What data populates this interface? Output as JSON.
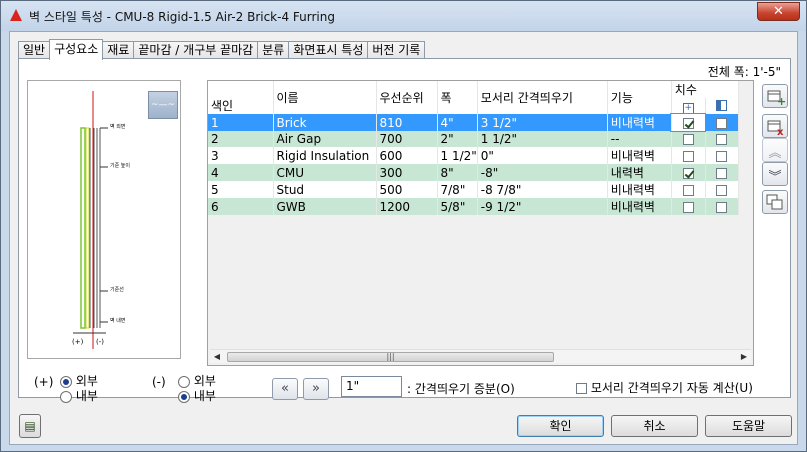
{
  "window": {
    "title": "벽 스타일 특성 - CMU-8 Rigid-1.5 Air-2 Brick-4 Furring",
    "close_glyph": "✕"
  },
  "tabs": [
    {
      "label": "일반"
    },
    {
      "label": "구성요소"
    },
    {
      "label": "재료"
    },
    {
      "label": "끝마감 / 개구부 끝마감"
    },
    {
      "label": "분류"
    },
    {
      "label": "화면표시 특성"
    },
    {
      "label": "버전 기록"
    }
  ],
  "total_width": "전체 폭: 1'-5\"",
  "preview": {
    "thumb_text": "~—~",
    "annotations": [
      "벽 외면",
      "기준 높이",
      "기준선",
      "벽 내면"
    ],
    "bottom_labels": [
      "(+)",
      "(-)"
    ]
  },
  "grid": {
    "headers": {
      "index": "색인",
      "name": "이름",
      "priority": "우선순위",
      "width": "폭",
      "edge_offset": "모서리 간격띄우기",
      "function": "기능",
      "dimension": "치수"
    },
    "rows": [
      {
        "index": "1",
        "name": "Brick",
        "priority": "810",
        "width": "4\"",
        "edge_offset": "3 1/2\"",
        "function": "비내력벽",
        "dim1": true,
        "dim2": false
      },
      {
        "index": "2",
        "name": "Air Gap",
        "priority": "700",
        "width": "2\"",
        "edge_offset": "1 1/2\"",
        "function": "--",
        "dim1": false,
        "dim2": false
      },
      {
        "index": "3",
        "name": "Rigid Insulation",
        "priority": "600",
        "width": "1 1/2\"",
        "edge_offset": "0\"",
        "function": "비내력벽",
        "dim1": false,
        "dim2": false
      },
      {
        "index": "4",
        "name": "CMU",
        "priority": "300",
        "width": "8\"",
        "edge_offset": "-8\"",
        "function": "내력벽",
        "dim1": true,
        "dim2": false
      },
      {
        "index": "5",
        "name": "Stud",
        "priority": "500",
        "width": "7/8\"",
        "edge_offset": "-8 7/8\"",
        "function": "비내력벽",
        "dim1": false,
        "dim2": false
      },
      {
        "index": "6",
        "name": "GWB",
        "priority": "1200",
        "width": "5/8\"",
        "edge_offset": "-9 1/2\"",
        "function": "비내력벽",
        "dim1": false,
        "dim2": false
      }
    ]
  },
  "side_buttons": [
    "add-component-icon",
    "delete-component-icon",
    "move-up-icon",
    "move-down-icon",
    "copy-component-icon"
  ],
  "plus_group": {
    "symbol": "(+)",
    "options": [
      "외부",
      "내부"
    ],
    "selected": "외부"
  },
  "minus_group": {
    "symbol": "(-)",
    "options": [
      "외부",
      "내부"
    ],
    "selected": "내부"
  },
  "offset": {
    "prev_glyph": "«",
    "next_glyph": "»",
    "value": "1\"",
    "label": ": 간격띄우기 증분(O)"
  },
  "auto_calc_label": "모서리 간격띄우기 자동 계산(U)",
  "buttons": {
    "ok": "확인",
    "cancel": "취소",
    "help": "도움말"
  }
}
